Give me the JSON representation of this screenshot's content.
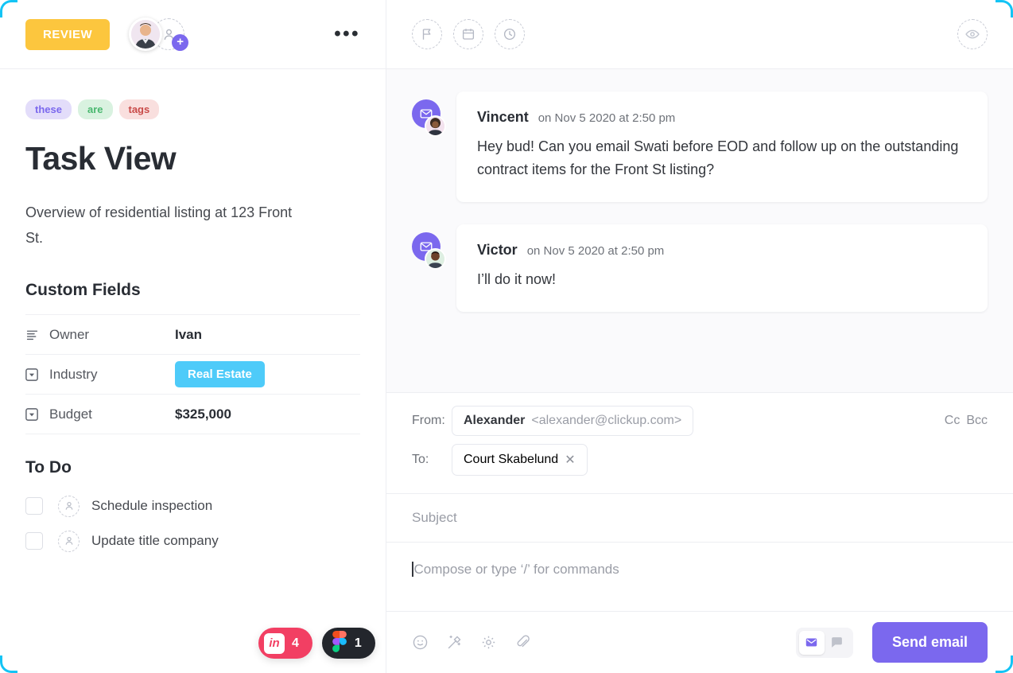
{
  "selection": {
    "accent_color": "#14C4F5"
  },
  "left_panel": {
    "header": {
      "status_label": "REVIEW",
      "status_color": "#FCC63E",
      "assignee_name": "Ivan",
      "add_assignee_label": "+",
      "more_label": "•••"
    },
    "tags": [
      {
        "label": "these",
        "bg": "#E3DDFA",
        "fg": "#7B68EE"
      },
      {
        "label": "are",
        "bg": "#D9F2E0",
        "fg": "#49B86F"
      },
      {
        "label": "tags",
        "bg": "#F9DFDE",
        "fg": "#C94B49"
      }
    ],
    "title": "Task View",
    "description": "Overview of residential listing at 123 Front St.",
    "custom_fields": {
      "heading": "Custom Fields",
      "rows": [
        {
          "icon": "text-lines-icon",
          "label": "Owner",
          "value": "Ivan",
          "type": "text"
        },
        {
          "icon": "dropdown-icon",
          "label": "Industry",
          "value": "Real  Estate",
          "type": "pill",
          "pill_color": "#4ECBF9"
        },
        {
          "icon": "dropdown-icon",
          "label": "Budget",
          "value": "$325,000",
          "type": "text"
        }
      ]
    },
    "todo": {
      "heading": "To Do",
      "items": [
        {
          "label": "Schedule inspection",
          "checked": false
        },
        {
          "label": "Update title company",
          "checked": false
        }
      ]
    },
    "float_badges": [
      {
        "app": "invision",
        "mark": "in",
        "count": "4",
        "color": "#F23F63"
      },
      {
        "app": "figma",
        "mark": "figma-logo",
        "count": "1",
        "color": "#23262C"
      }
    ]
  },
  "right_panel": {
    "header": {
      "icons": [
        "flag-icon",
        "calendar-icon",
        "clock-icon"
      ],
      "watch_icon": "eye-icon"
    },
    "comments": [
      {
        "author": "Vincent",
        "timestamp": "on Nov 5 2020 at 2:50 pm",
        "text": "Hey bud! Can you email Swati before EOD and follow up on the outstanding contract items for the Front St listing?",
        "channel_icon": "envelope-icon"
      },
      {
        "author": "Victor",
        "timestamp": "on Nov 5 2020 at 2:50 pm",
        "text": "I’ll do it now!",
        "channel_icon": "envelope-icon"
      }
    ],
    "composer": {
      "from_label": "From:",
      "from_name": "Alexander",
      "from_email": "<alexander@clickup.com>",
      "to_label": "To:",
      "to_chip": "Court Skabelund",
      "to_chip_remove": "✕",
      "cc_label": "Cc",
      "bcc_label": "Bcc",
      "subject_placeholder": "Subject",
      "subject_value": "",
      "body_placeholder": "Compose or type ‘/’ for commands",
      "body_value": "",
      "toolbar_icons": [
        "emoji-icon",
        "magic-wand-icon",
        "gear-icon",
        "attachment-icon"
      ],
      "mode_email": "envelope-icon",
      "mode_comment": "comment-bubble-icon",
      "active_mode": "email",
      "send_label": "Send email",
      "send_color": "#7B68EE"
    }
  }
}
